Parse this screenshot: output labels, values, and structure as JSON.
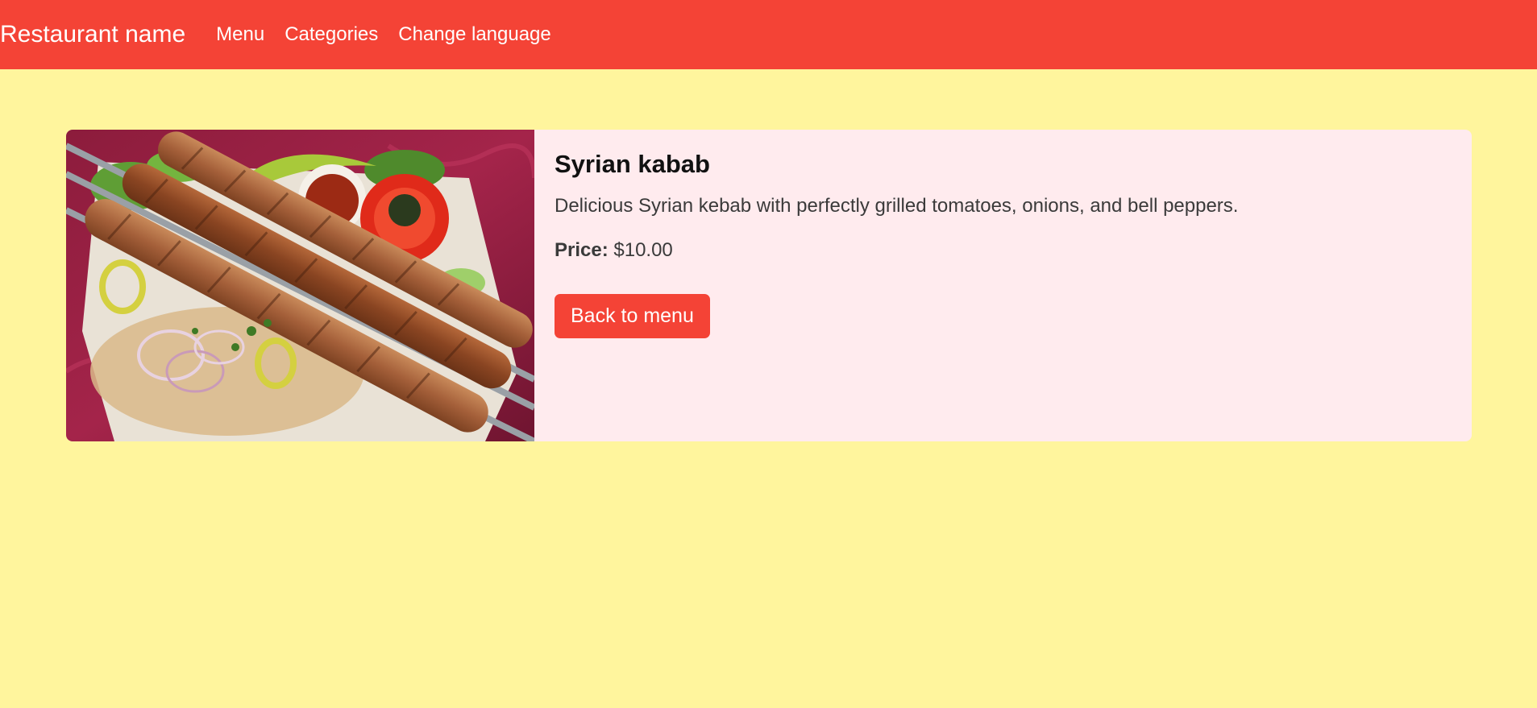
{
  "navbar": {
    "brand": "Restaurant name",
    "links": [
      {
        "label": "Menu"
      },
      {
        "label": "Categories"
      },
      {
        "label": "Change language"
      }
    ],
    "color": "#f44336"
  },
  "page": {
    "background": "#fff59d"
  },
  "dish": {
    "name": "Syrian kabab",
    "description": "Delicious Syrian kebab with perfectly grilled tomatoes, onions, and bell peppers.",
    "price_label": "Price:",
    "price_value": "$10.00",
    "back_label": "Back to menu",
    "image_subject": "kebab-platter-photo",
    "card_color": "#ffebee"
  }
}
